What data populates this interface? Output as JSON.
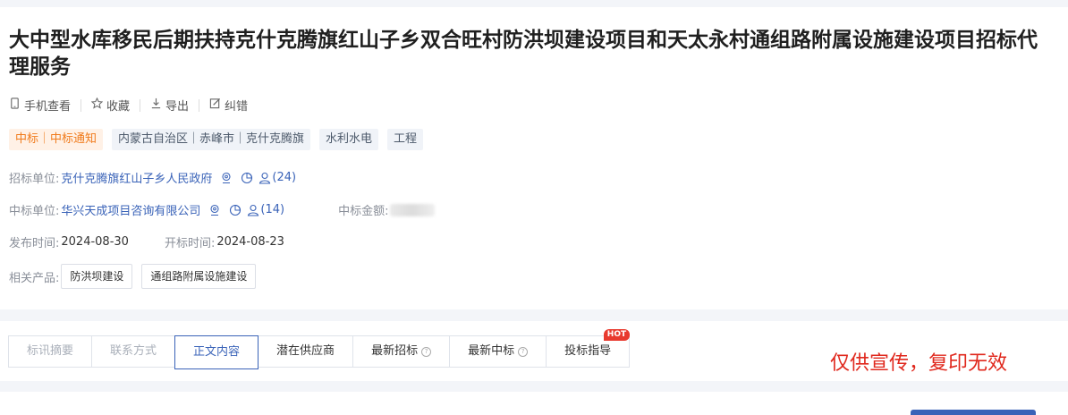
{
  "header": {
    "title": "大中型水库移民后期扶持克什克腾旗红山子乡双合旺村防洪坝建设项目和天太永村通组路附属设施建设项目招标代理服务"
  },
  "actions": [
    {
      "label": "手机查看",
      "icon": "phone-icon"
    },
    {
      "label": "收藏",
      "icon": "star-icon"
    },
    {
      "label": "导出",
      "icon": "download-icon"
    },
    {
      "label": "纠错",
      "icon": "edit-icon"
    }
  ],
  "tags": {
    "type": "中标｜中标通知",
    "region": "内蒙古自治区｜赤峰市｜克什克腾旗",
    "industry": "水利水电",
    "category": "工程"
  },
  "bidder": {
    "label": "招标单位:",
    "name": "克什克腾旗红山子乡人民政府",
    "count": "(24)"
  },
  "winner": {
    "label": "中标单位:",
    "name": "华兴天成项目咨询有限公司",
    "count": "(14)",
    "amount_label": "中标金额:"
  },
  "dates": {
    "publish_label": "发布时间:",
    "publish_value": "2024-08-30",
    "open_label": "开标时间:",
    "open_value": "2024-08-23"
  },
  "products": {
    "label": "相关产品:",
    "items": [
      "防洪坝建设",
      "通组路附属设施建设"
    ]
  },
  "tabs": [
    {
      "label": "标讯摘要"
    },
    {
      "label": "联系方式"
    },
    {
      "label": "正文内容"
    },
    {
      "label": "潜在供应商"
    },
    {
      "label": "最新招标"
    },
    {
      "label": "最新中标"
    },
    {
      "label": "投标指导",
      "badge": "HOT"
    }
  ],
  "watermark": "仅供宣传，复印无效",
  "colors": {
    "accent": "#3a63b8",
    "orange": "#f07b1c",
    "hot": "#e83a2e",
    "watermark": "#e0281d"
  }
}
